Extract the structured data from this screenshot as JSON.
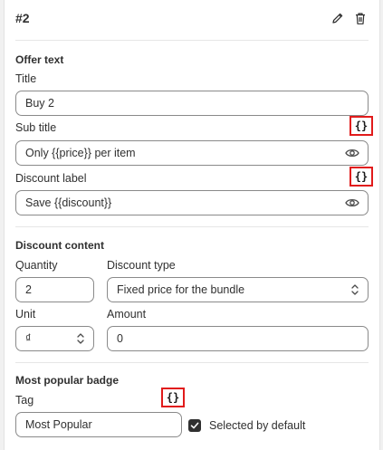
{
  "header": {
    "title": "#2"
  },
  "offer": {
    "section_title": "Offer text",
    "title_label": "Title",
    "title_value": "Buy 2",
    "subtitle_label": "Sub title",
    "subtitle_value": "Only {{price}} per item",
    "discount_label_label": "Discount label",
    "discount_label_value": "Save {{discount}}",
    "variable_button_text": "{}"
  },
  "discount": {
    "section_title": "Discount content",
    "quantity_label": "Quantity",
    "quantity_value": "2",
    "type_label": "Discount type",
    "type_value": "Fixed price for the bundle",
    "unit_label": "Unit",
    "unit_value": "₫",
    "amount_label": "Amount",
    "amount_value": "0"
  },
  "badge": {
    "section_title": "Most popular badge",
    "tag_label": "Tag",
    "tag_value": "Most Popular",
    "selected_default_label": "Selected by default",
    "selected_default_checked": true
  },
  "colors": {
    "highlight_border": "#e11b1b",
    "text": "#303030",
    "input_border": "#8a8a8a"
  }
}
